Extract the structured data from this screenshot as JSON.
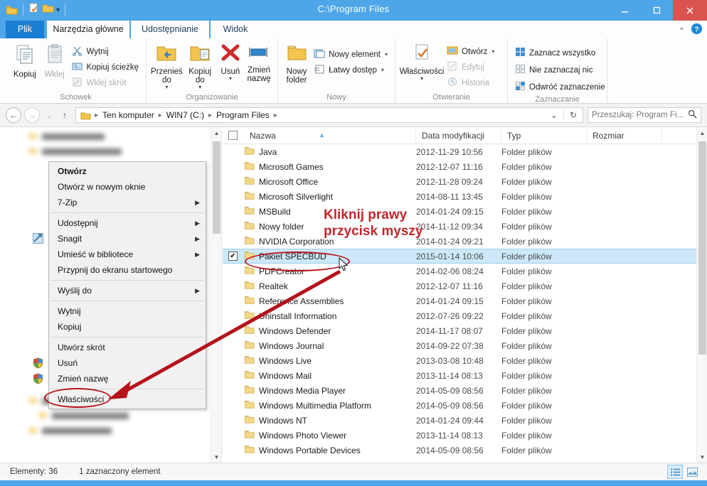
{
  "window": {
    "title": "C:\\Program Files",
    "minimize_label": "—",
    "maximize_label": "❐",
    "close_label": "✕",
    "qat": [
      "folder-icon",
      "new-folder-icon",
      "properties-icon",
      "customize-caret-icon"
    ]
  },
  "tabs": [
    {
      "id": "file",
      "label": "Plik"
    },
    {
      "id": "home",
      "label": "Narzędzia główne"
    },
    {
      "id": "share",
      "label": "Udostępnianie"
    },
    {
      "id": "view",
      "label": "Widok"
    }
  ],
  "ribbon": {
    "collapse_label": "⌃",
    "help_label": "?",
    "groups": [
      {
        "id": "clipboard",
        "title": "Schowek",
        "big": [
          {
            "label": "Kopiuj",
            "icon": "copy-icon",
            "dim": false
          },
          {
            "label": "Wklej",
            "icon": "paste-icon",
            "dim": true
          }
        ],
        "small": [
          {
            "label": "Wytnij",
            "icon": "scissors-icon",
            "dim": false
          },
          {
            "label": "Kopiuj ścieżkę",
            "icon": "copy-path-icon",
            "dim": false
          },
          {
            "label": "Wklej skrót",
            "icon": "paste-shortcut-icon",
            "dim": true
          }
        ]
      },
      {
        "id": "organize",
        "title": "Organizowanie",
        "big": [
          {
            "label": "Przenieś do",
            "icon": "move-to-icon",
            "caret": true
          },
          {
            "label": "Kopiuj do",
            "icon": "copy-to-icon",
            "caret": true
          },
          {
            "label": "Usuń",
            "icon": "delete-icon",
            "caret": true
          },
          {
            "label": "Zmień nazwę",
            "icon": "rename-icon",
            "caret": false
          }
        ]
      },
      {
        "id": "new",
        "title": "Nowy",
        "big": [
          {
            "label": "Nowy folder",
            "icon": "new-folder-icon",
            "caret": false
          }
        ],
        "small": [
          {
            "label": "Nowy element",
            "icon": "new-item-icon",
            "caret": true
          },
          {
            "label": "Łatwy dostęp",
            "icon": "easy-access-icon",
            "caret": true
          }
        ]
      },
      {
        "id": "open",
        "title": "Otwieranie",
        "big": [
          {
            "label": "Właściwości",
            "icon": "properties-icon",
            "caret": true
          }
        ],
        "small": [
          {
            "label": "Otwórz",
            "icon": "open-icon",
            "caret": true,
            "dim": false
          },
          {
            "label": "Edytuj",
            "icon": "edit-icon",
            "dim": true
          },
          {
            "label": "Historia",
            "icon": "history-icon",
            "dim": true
          }
        ]
      },
      {
        "id": "select",
        "title": "Zaznaczanie",
        "small": [
          {
            "label": "Zaznacz wszystko",
            "icon": "select-all-icon"
          },
          {
            "label": "Nie zaznaczaj nic",
            "icon": "select-none-icon"
          },
          {
            "label": "Odwróć zaznaczenie",
            "icon": "invert-selection-icon"
          }
        ]
      }
    ]
  },
  "addressbar": {
    "back_label": "←",
    "forward_label": "→",
    "recent_label": "⌄",
    "up_label": "↑",
    "breadcrumbs": [
      "Ten komputer",
      "WIN7 (C:)",
      "Program Files"
    ],
    "separator": "▸",
    "dropdown_label": "⌄",
    "refresh_label": "↻",
    "search_placeholder": "Przeszukaj: Program Fi...",
    "search_value": "",
    "search_icon": "search-icon"
  },
  "columns": [
    {
      "key": "name",
      "label": "Nazwa"
    },
    {
      "key": "date",
      "label": "Data modyfikacji"
    },
    {
      "key": "type",
      "label": "Typ"
    },
    {
      "key": "size",
      "label": "Rozmiar"
    }
  ],
  "files": [
    {
      "name": "Java",
      "date": "2012-11-29 10:56",
      "type": "Folder plików",
      "size": "",
      "selected": false
    },
    {
      "name": "Microsoft Games",
      "date": "2012-12-07 11:16",
      "type": "Folder plików",
      "size": "",
      "selected": false
    },
    {
      "name": "Microsoft Office",
      "date": "2012-11-28 09:24",
      "type": "Folder plików",
      "size": "",
      "selected": false
    },
    {
      "name": "Microsoft Silverlight",
      "date": "2014-08-11 13:45",
      "type": "Folder plików",
      "size": "",
      "selected": false
    },
    {
      "name": "MSBuild",
      "date": "2014-01-24 09:15",
      "type": "Folder plików",
      "size": "",
      "selected": false
    },
    {
      "name": "Nowy folder",
      "date": "2014-11-12 09:34",
      "type": "Folder plików",
      "size": "",
      "selected": false
    },
    {
      "name": "NVIDIA Corporation",
      "date": "2014-01-24 09:21",
      "type": "Folder plików",
      "size": "",
      "selected": false
    },
    {
      "name": "Pakiet SPECBUD",
      "date": "2015-01-14 10:06",
      "type": "Folder plików",
      "size": "",
      "selected": true
    },
    {
      "name": "PDFCreator",
      "date": "2014-02-06 08:24",
      "type": "Folder plików",
      "size": "",
      "selected": false
    },
    {
      "name": "Realtek",
      "date": "2012-12-07 11:16",
      "type": "Folder plików",
      "size": "",
      "selected": false
    },
    {
      "name": "Reference Assemblies",
      "date": "2014-01-24 09:15",
      "type": "Folder plików",
      "size": "",
      "selected": false
    },
    {
      "name": "Uninstall Information",
      "date": "2012-07-26 09:22",
      "type": "Folder plików",
      "size": "",
      "selected": false
    },
    {
      "name": "Windows Defender",
      "date": "2014-11-17 08:07",
      "type": "Folder plików",
      "size": "",
      "selected": false
    },
    {
      "name": "Windows Journal",
      "date": "2014-09-22 07:38",
      "type": "Folder plików",
      "size": "",
      "selected": false
    },
    {
      "name": "Windows Live",
      "date": "2013-03-08 10:48",
      "type": "Folder plików",
      "size": "",
      "selected": false
    },
    {
      "name": "Windows Mail",
      "date": "2013-11-14 08:13",
      "type": "Folder plików",
      "size": "",
      "selected": false
    },
    {
      "name": "Windows Media Player",
      "date": "2014-05-09 08:56",
      "type": "Folder plików",
      "size": "",
      "selected": false
    },
    {
      "name": "Windows Multimedia Platform",
      "date": "2014-05-09 08:56",
      "type": "Folder plików",
      "size": "",
      "selected": false
    },
    {
      "name": "Windows NT",
      "date": "2014-01-24 09:44",
      "type": "Folder plików",
      "size": "",
      "selected": false
    },
    {
      "name": "Windows Photo Viewer",
      "date": "2013-11-14 08:13",
      "type": "Folder plików",
      "size": "",
      "selected": false
    },
    {
      "name": "Windows Portable Devices",
      "date": "2014-05-09 08:56",
      "type": "Folder plików",
      "size": "",
      "selected": false
    }
  ],
  "context_menu": [
    {
      "label": "Otwórz",
      "bold": true,
      "arrow": false,
      "shield": false,
      "gutter_icon": ""
    },
    {
      "label": "Otwórz w nowym oknie",
      "bold": false,
      "arrow": false,
      "shield": false,
      "gutter_icon": ""
    },
    {
      "label": "7-Zip",
      "bold": false,
      "arrow": true,
      "shield": false,
      "gutter_icon": ""
    },
    {
      "separator": true
    },
    {
      "label": "Udostępnij",
      "bold": false,
      "arrow": true,
      "shield": false,
      "gutter_icon": ""
    },
    {
      "label": "Snagit",
      "bold": false,
      "arrow": true,
      "shield": false,
      "gutter_icon": "snagit-icon"
    },
    {
      "label": "Umieść w bibliotece",
      "bold": false,
      "arrow": true,
      "shield": false,
      "gutter_icon": ""
    },
    {
      "label": "Przypnij do ekranu startowego",
      "bold": false,
      "arrow": false,
      "shield": false,
      "gutter_icon": ""
    },
    {
      "separator": true
    },
    {
      "label": "Wyślij do",
      "bold": false,
      "arrow": true,
      "shield": false,
      "gutter_icon": ""
    },
    {
      "separator": true
    },
    {
      "label": "Wytnij",
      "bold": false,
      "arrow": false,
      "shield": false,
      "gutter_icon": ""
    },
    {
      "label": "Kopiuj",
      "bold": false,
      "arrow": false,
      "shield": false,
      "gutter_icon": ""
    },
    {
      "separator": true
    },
    {
      "label": "Utwórz skrót",
      "bold": false,
      "arrow": false,
      "shield": false,
      "gutter_icon": ""
    },
    {
      "label": "Usuń",
      "bold": false,
      "arrow": false,
      "shield": true,
      "gutter_icon": "shield-icon"
    },
    {
      "label": "Zmień nazwę",
      "bold": false,
      "arrow": false,
      "shield": true,
      "gutter_icon": "shield-icon"
    },
    {
      "separator": true
    },
    {
      "label": "Właściwości",
      "bold": false,
      "arrow": false,
      "shield": false,
      "gutter_icon": ""
    }
  ],
  "annotations": {
    "line1": "Kliknij prawy",
    "line2": "przycisk myszy",
    "color": "#c1272d"
  },
  "statusbar": {
    "items_label": "Elementy: 36",
    "selection_label": "1 zaznaczony element",
    "view_details_icon": "details-view-icon",
    "view_thumbs_icon": "large-icons-view-icon"
  }
}
